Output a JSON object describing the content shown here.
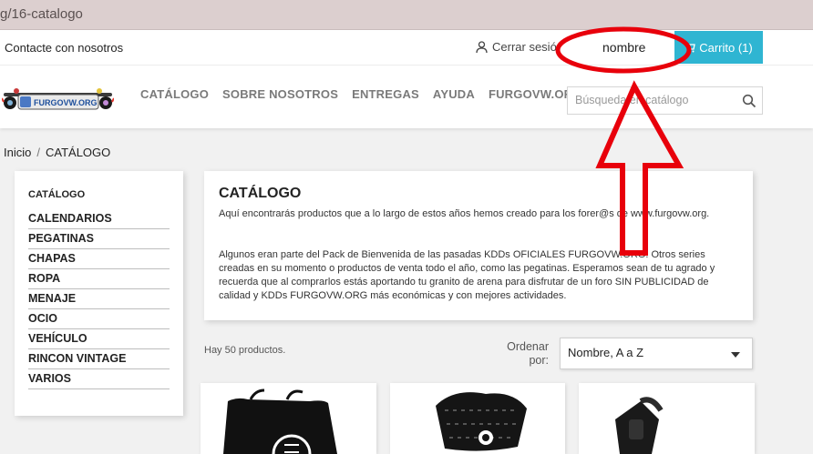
{
  "browser": {
    "url": "g/16-catalogo"
  },
  "topnav": {
    "contact": "Contacte con nosotros",
    "signout": "Cerrar sesió",
    "user_name": "nombre",
    "cart": "Carrito (1)"
  },
  "header": {
    "logo_text": "FURGOVW.ORG",
    "menu": [
      "CATÁLOGO",
      "SOBRE NOSOTROS",
      "ENTREGAS",
      "AYUDA",
      "FURGOVW.ORG"
    ],
    "search_placeholder": "Búsqueda en catálogo"
  },
  "breadcrumb": {
    "home": "Inicio",
    "sep": "/",
    "current": "CATÁLOGO"
  },
  "sidebar": {
    "title": "CATÁLOGO",
    "items": [
      "CALENDARIOS",
      "PEGATINAS",
      "CHAPAS",
      "ROPA",
      "MENAJE",
      "OCIO",
      "VEHÍCULO",
      "RINCON VINTAGE",
      "VARIOS"
    ]
  },
  "category": {
    "title": "CATÁLOGO",
    "p1": "Aquí encontrarás productos que a lo largo de estos años hemos creado para los forer@s de www.furgovw.org.",
    "p2": "Algunos eran parte del Pack de Bienvenida de las pasadas KDDs OFICIALES FURGOVW.ORG. Otros series creadas en su momento o productos de venta todo el año, como las pegatinas. Esperamos sean de tu agrado y recuerda que al comprarlos estás aportando tu granito de arena para disfrutar de un foro SIN PUBLICIDAD de calidad y KDDs FURGOVW.ORG más económicas y con mejores actividades."
  },
  "listing": {
    "count": "Hay 50 productos.",
    "sort_label": "Ordenar por:",
    "sort_value": "Nombre, A a Z"
  },
  "colors": {
    "accent": "#2fb5d2",
    "annotation": "#e8000b"
  }
}
